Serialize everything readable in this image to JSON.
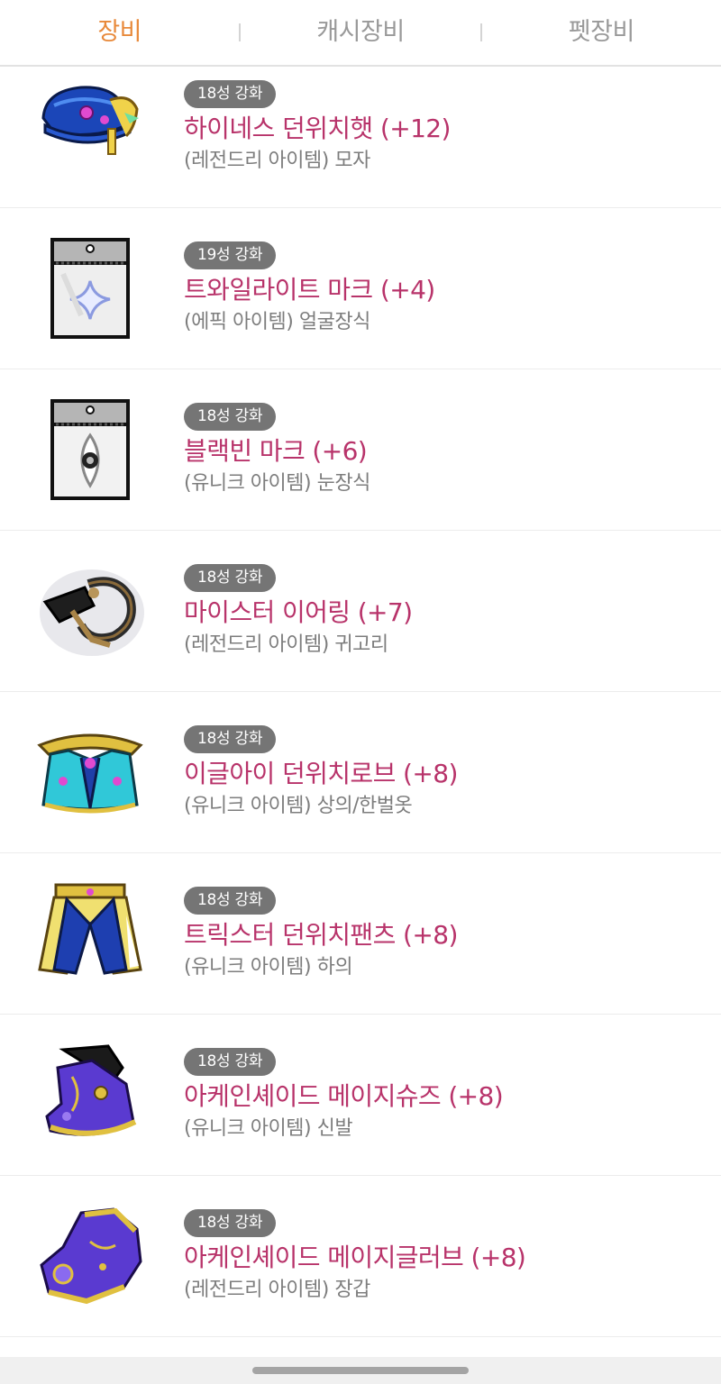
{
  "tabs": [
    {
      "label": "장비",
      "active": true
    },
    {
      "label": "캐시장비",
      "active": false
    },
    {
      "label": "펫장비",
      "active": false
    }
  ],
  "items": [
    {
      "badge": "18성 강화",
      "name": "하이네스 던위치햇 (+12)",
      "sub": "(레전드리 아이템) 모자",
      "icon": "hat-icon"
    },
    {
      "badge": "19성 강화",
      "name": "트와일라이트 마크 (+4)",
      "sub": "(에픽 아이템) 얼굴장식",
      "icon": "face-accessory-icon"
    },
    {
      "badge": "18성 강화",
      "name": "블랙빈 마크 (+6)",
      "sub": "(유니크 아이템) 눈장식",
      "icon": "eye-accessory-icon"
    },
    {
      "badge": "18성 강화",
      "name": "마이스터 이어링 (+7)",
      "sub": "(레전드리 아이템) 귀고리",
      "icon": "earring-icon"
    },
    {
      "badge": "18성 강화",
      "name": "이글아이 던위치로브 (+8)",
      "sub": "(유니크 아이템) 상의/한벌옷",
      "icon": "robe-icon"
    },
    {
      "badge": "18성 강화",
      "name": "트릭스터 던위치팬츠 (+8)",
      "sub": "(유니크 아이템) 하의",
      "icon": "pants-icon"
    },
    {
      "badge": "18성 강화",
      "name": "아케인셰이드 메이지슈즈 (+8)",
      "sub": "(유니크 아이템) 신발",
      "icon": "shoes-icon"
    },
    {
      "badge": "18성 강화",
      "name": "아케인셰이드 메이지글러브 (+8)",
      "sub": "(레전드리 아이템) 장갑",
      "icon": "gloves-icon"
    }
  ],
  "colors": {
    "active_tab": "#e8893a",
    "item_name": "#b8336a",
    "badge_bg": "#757575"
  }
}
